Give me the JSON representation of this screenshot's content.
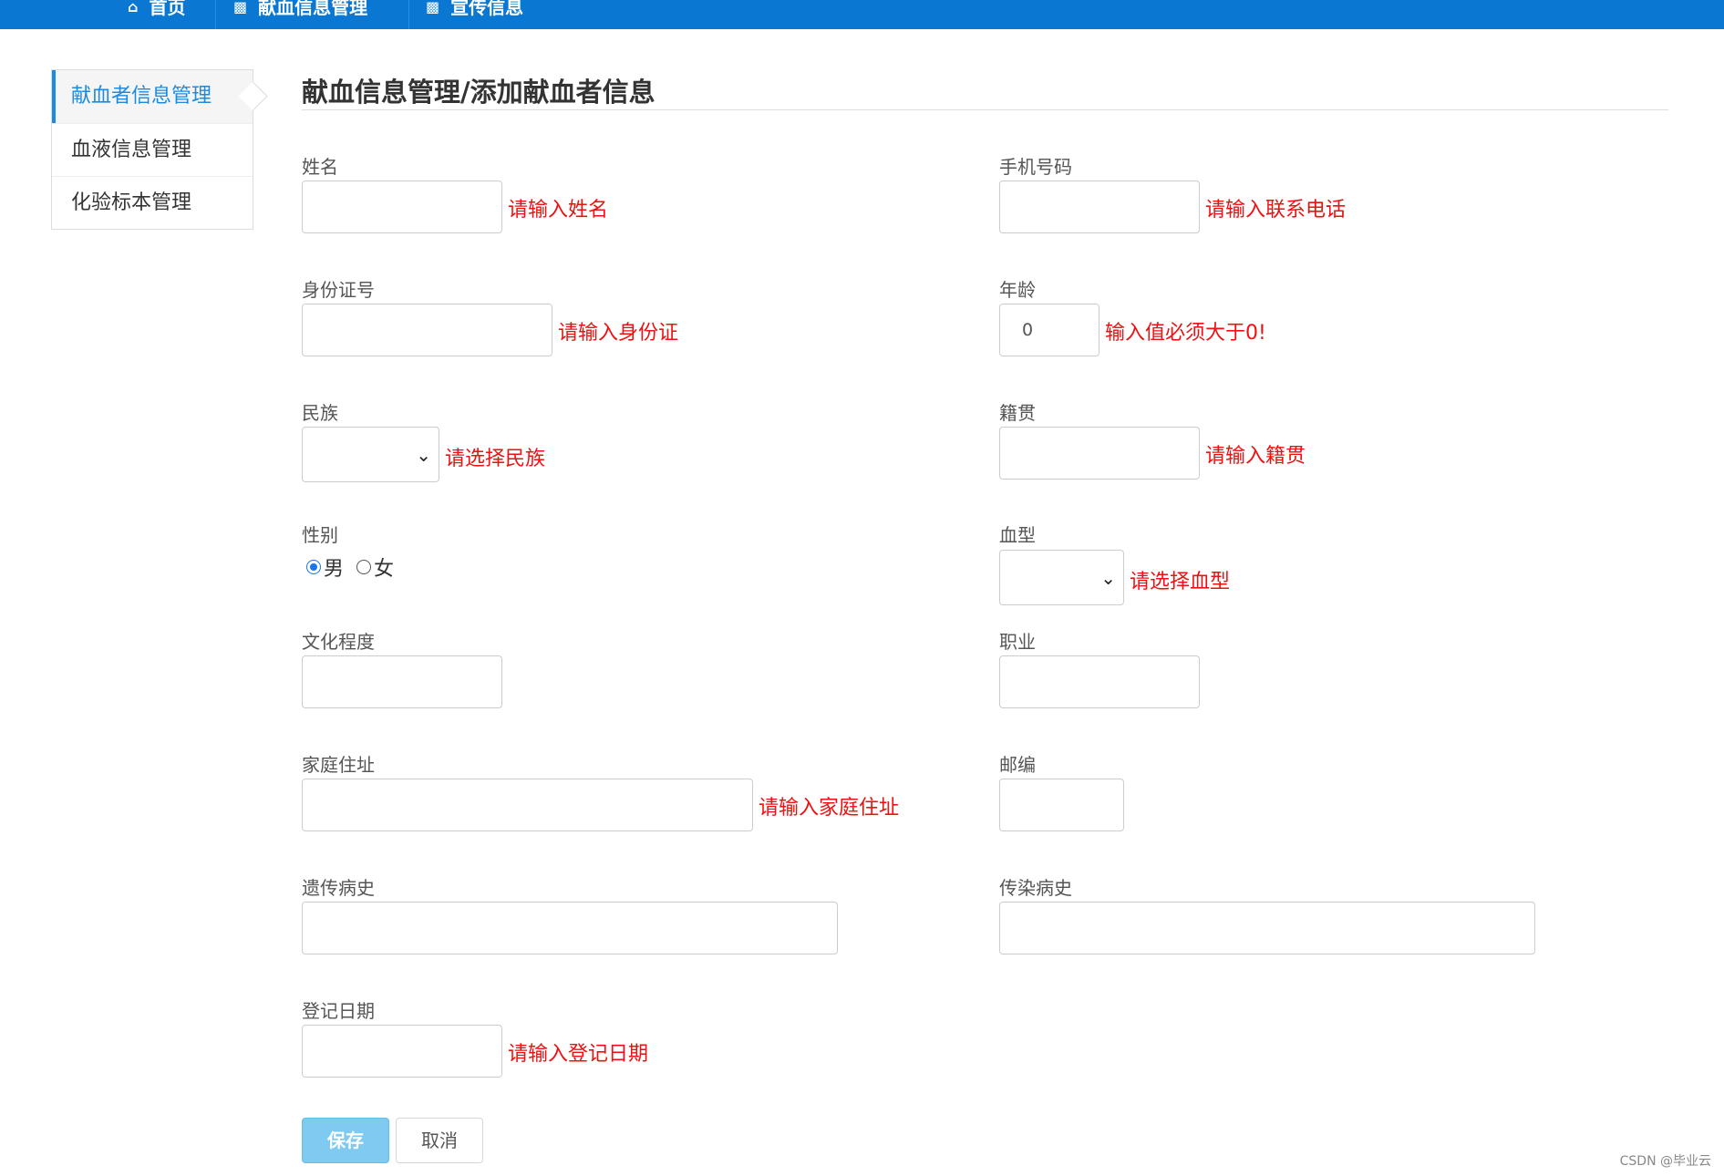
{
  "nav": {
    "items": [
      {
        "icon": "home-icon",
        "label": "首页"
      },
      {
        "icon": "sitemap-icon",
        "label": "献血信息管理"
      },
      {
        "icon": "sitemap-icon",
        "label": "宣传信息"
      }
    ]
  },
  "sidebar": {
    "items": [
      {
        "label": "献血者信息管理",
        "active": true
      },
      {
        "label": "血液信息管理"
      },
      {
        "label": "化验标本管理"
      }
    ]
  },
  "page": {
    "title": "献血信息管理/添加献血者信息"
  },
  "form": {
    "name": {
      "label": "姓名",
      "value": "",
      "hint": "请输入姓名"
    },
    "phone": {
      "label": "手机号码",
      "value": "",
      "hint": "请输入联系电话"
    },
    "id_number": {
      "label": "身份证号",
      "value": "",
      "hint": "请输入身份证"
    },
    "age": {
      "label": "年龄",
      "value": "0",
      "hint": "输入值必须大于0!"
    },
    "ethnicity": {
      "label": "民族",
      "value": "",
      "hint": "请选择民族"
    },
    "native_place": {
      "label": "籍贯",
      "value": "",
      "hint": "请输入籍贯"
    },
    "gender": {
      "label": "性别",
      "options": [
        "男",
        "女"
      ],
      "selected": "男"
    },
    "blood_type": {
      "label": "血型",
      "value": "",
      "hint": "请选择血型"
    },
    "education": {
      "label": "文化程度",
      "value": ""
    },
    "occupation": {
      "label": "职业",
      "value": ""
    },
    "address": {
      "label": "家庭住址",
      "value": "",
      "hint": "请输入家庭住址"
    },
    "postcode": {
      "label": "邮编",
      "value": ""
    },
    "genetic_history": {
      "label": "遗传病史",
      "value": ""
    },
    "infectious_history": {
      "label": "传染病史",
      "value": ""
    },
    "register_date": {
      "label": "登记日期",
      "value": "",
      "hint": "请输入登记日期"
    }
  },
  "buttons": {
    "save": "保存",
    "cancel": "取消"
  },
  "watermark": "CSDN @毕业云",
  "colors": {
    "topbar": "#0a78d2",
    "accent": "#1a8be0",
    "hint": "#ee1111",
    "save_button": "#7fcaf0"
  }
}
